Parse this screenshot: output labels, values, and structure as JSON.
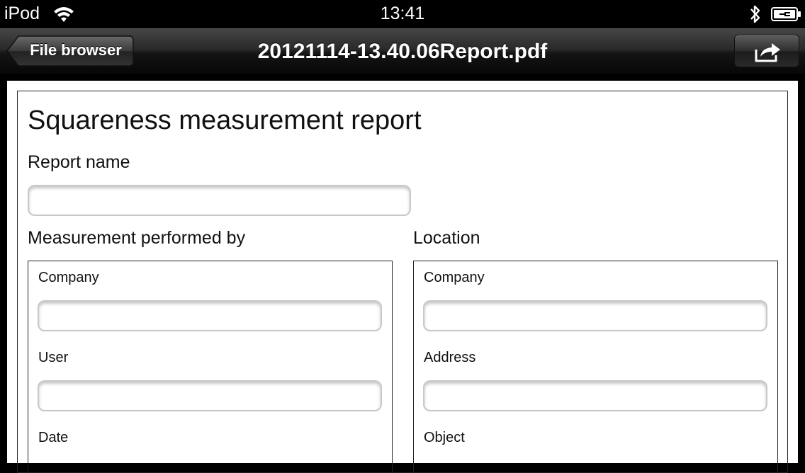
{
  "status_bar": {
    "carrier": "iPod",
    "time": "13:41"
  },
  "nav": {
    "back_label": "File browser",
    "title": "20121114-13.40.06Report.pdf"
  },
  "report": {
    "title": "Squareness measurement report",
    "report_name_label": "Report name",
    "performed_by": {
      "heading": "Measurement performed by",
      "fields": [
        "Company",
        "User",
        "Date"
      ]
    },
    "location": {
      "heading": "Location",
      "fields": [
        "Company",
        "Address",
        "Object"
      ]
    }
  }
}
